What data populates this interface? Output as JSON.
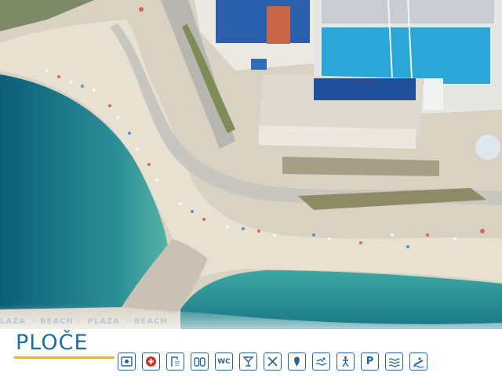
{
  "footer": {
    "tagline": [
      "LAŽA",
      "· BEACH ·",
      "PLAŽA",
      "· BEACH"
    ],
    "title": "PLOČE",
    "accent_color": "#e8b917",
    "icon_color": "#1f66a3",
    "amenities": [
      {
        "name": "lifeguard-icon"
      },
      {
        "name": "first-aid-icon"
      },
      {
        "name": "shower-icon"
      },
      {
        "name": "changing-cabin-icon"
      },
      {
        "name": "toilet-icon",
        "label": "WC"
      },
      {
        "name": "bar-icon"
      },
      {
        "name": "restaurant-icon"
      },
      {
        "name": "ice-cream-icon"
      },
      {
        "name": "swimming-icon"
      },
      {
        "name": "sports-icon"
      },
      {
        "name": "parking-icon",
        "label": "P"
      },
      {
        "name": "swimming-pool-icon"
      },
      {
        "name": "water-sports-icon"
      }
    ]
  }
}
